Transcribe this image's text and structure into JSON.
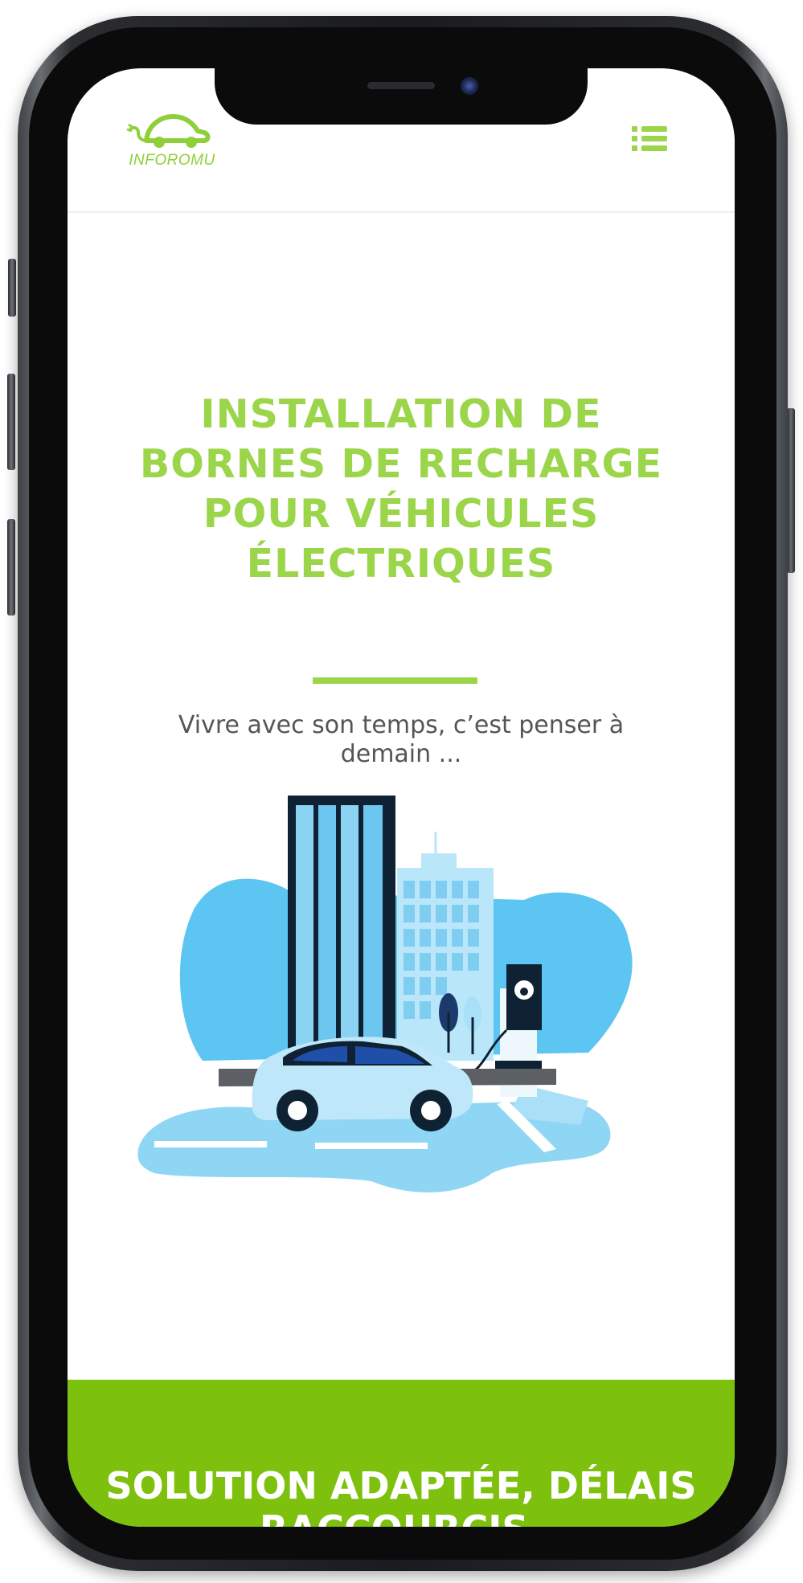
{
  "header": {
    "logo_text": "INFOROMU",
    "menu_icon": "list-menu-icon"
  },
  "hero": {
    "title": "INSTALLATION DE BORNES DE RECHARGE POUR VÉHICULES ÉLECTRIQUES",
    "subtitle": "Vivre avec son temps, c’est penser à demain ...",
    "illustration_icon": "ev-charging-city-illustration"
  },
  "band": {
    "title": "SOLUTION ADAPTÉE, DÉLAIS RACCOURCIS,"
  },
  "colors": {
    "brand_green": "#9bd54a",
    "band_green": "#7dc00e",
    "text_gray": "#555555",
    "illustration_blue": "#5cc5f2"
  }
}
